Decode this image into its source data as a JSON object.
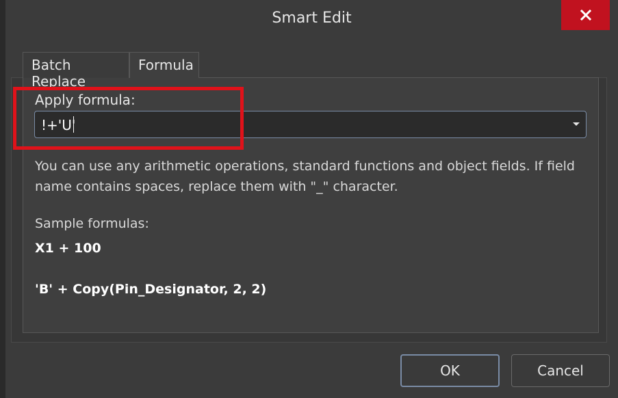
{
  "window": {
    "title": "Smart Edit"
  },
  "icons": {
    "close": "close-icon",
    "dropdown": "chevron-down-icon"
  },
  "tabs": [
    {
      "label": "Batch Replace",
      "active": false
    },
    {
      "label": "Formula",
      "active": true
    }
  ],
  "formula": {
    "label": "Apply formula:",
    "value": "!+'U'"
  },
  "help": {
    "text": "You can use any arithmetic operations, standard functions and object fields. If field name contains spaces, replace them with \"_\" character.",
    "samples_label": "Sample formulas:",
    "samples": [
      "X1 + 100",
      "'B' + Copy(Pin_Designator, 2, 2)"
    ]
  },
  "buttons": {
    "ok": "OK",
    "cancel": "Cancel"
  },
  "colors": {
    "close_bg": "#c1121f",
    "highlight": "#e0121a",
    "focus_border": "#7a8ca6"
  }
}
